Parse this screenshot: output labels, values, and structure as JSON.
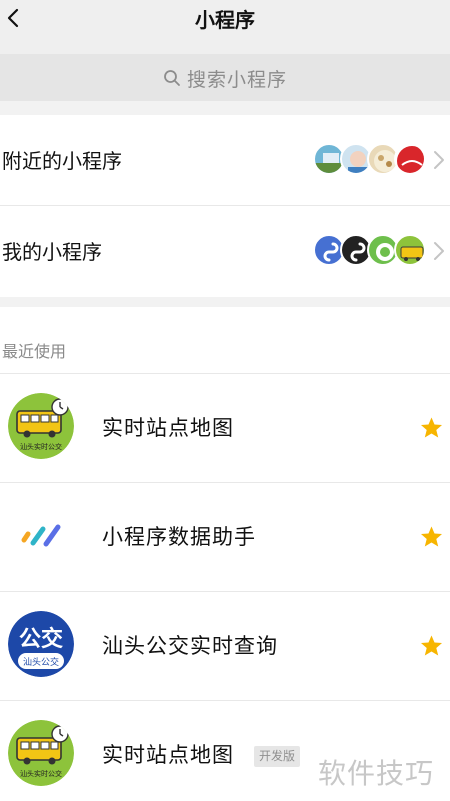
{
  "navbar": {
    "title": "小程序"
  },
  "search": {
    "placeholder": "搜索小程序"
  },
  "entries": [
    {
      "label": "附近的小程序"
    },
    {
      "label": "我的小程序"
    }
  ],
  "recent": {
    "header": "最近使用",
    "items": [
      {
        "name": "实时站点地图",
        "icon_caption": "汕头实时公交",
        "starred": true
      },
      {
        "name": "小程序数据助手",
        "starred": true
      },
      {
        "name": "汕头公交实时查询",
        "icon_title": "公交",
        "icon_caption": "汕头公交",
        "starred": true
      },
      {
        "name": "实时站点地图",
        "icon_caption": "汕头实时公交",
        "tag": "开发版",
        "starred": false
      }
    ]
  },
  "overlay": {
    "watermark": "软件技巧"
  },
  "colors": {
    "star": "#f7b500",
    "bus_badge": "#8dc33b",
    "bus_body": "#f2c515",
    "gongjiao_blue": "#1d48a8"
  }
}
